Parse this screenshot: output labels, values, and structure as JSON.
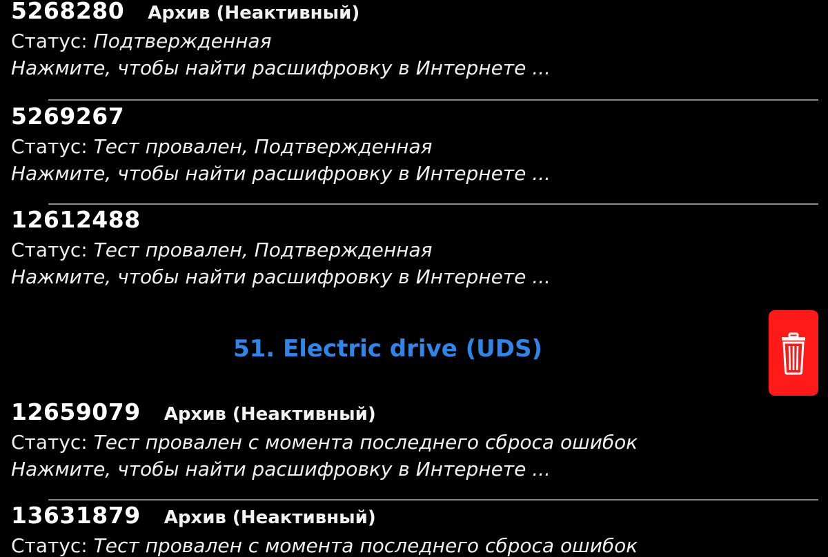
{
  "entries_top": [
    {
      "code": "5268280",
      "tag": "Архив (Неактивный)",
      "status_label": "Статус: ",
      "status_value": "Подтвержденная",
      "hint": "Нажмите, чтобы найти расшифровку в Интернете ..."
    },
    {
      "code": "5269267",
      "tag": "",
      "status_label": "Статус: ",
      "status_value": "Тест провален, Подтвержденная",
      "hint": "Нажмите, чтобы найти расшифровку в Интернете ..."
    },
    {
      "code": "12612488",
      "tag": "",
      "status_label": "Статус: ",
      "status_value": "Тест провален, Подтвержденная",
      "hint": "Нажмите, чтобы найти расшифровку в Интернете ..."
    }
  ],
  "section": {
    "title": "51. Electric drive (UDS)"
  },
  "entries_bottom": [
    {
      "code": "12659079",
      "tag": "Архив (Неактивный)",
      "status_label": "Статус: ",
      "status_value": "Тест провален с момента последнего сброса ошибок",
      "hint": "Нажмите, чтобы найти расшифровку в Интернете ..."
    },
    {
      "code": "13631879",
      "tag": "Архив (Неактивный)",
      "status_label": "Статус: ",
      "status_value": "Тест провален с момента последнего сброса ошибок",
      "hint": ""
    }
  ],
  "delete_action": {
    "icon": "trash-icon",
    "color": "#ff1a1a"
  },
  "colors": {
    "background": "#000000",
    "section_title": "#2f86e8",
    "divider": "#8a8a8a"
  }
}
